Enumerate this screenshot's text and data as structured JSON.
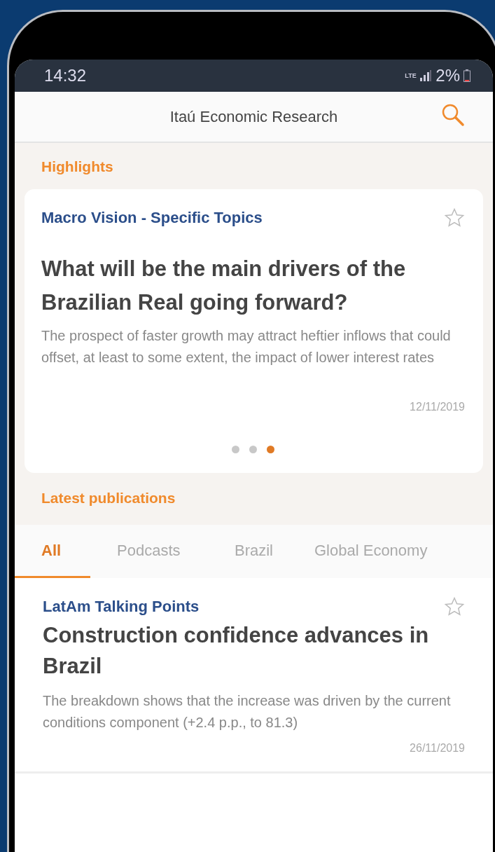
{
  "status_bar": {
    "time": "14:32",
    "network": "LTE",
    "battery": "2%"
  },
  "app_bar": {
    "title": "Itaú Economic Research"
  },
  "highlights": {
    "heading": "Highlights",
    "card": {
      "category": "Macro Vision - Specific Topics",
      "bookmarked": false,
      "title": "What will be the main drivers of the Brazilian Real going forward?",
      "summary": "The prospect of faster growth may attract heftier inflows that could offset, at least to some extent, the impact of lower interest rates",
      "date": "12/11/2019"
    },
    "dots": [
      {
        "selected": false
      },
      {
        "selected": false
      },
      {
        "selected": true
      }
    ]
  },
  "latest": {
    "heading": "Latest publications",
    "tabs": [
      {
        "label": "All",
        "selected": true
      },
      {
        "label": "Podcasts",
        "selected": false
      },
      {
        "label": "Brazil",
        "selected": false
      },
      {
        "label": "Global Economy",
        "selected": false
      }
    ],
    "articles": [
      {
        "category": "LatAm Talking Points",
        "bookmarked": false,
        "title": "Construction confidence advances in Brazil",
        "summary": "The breakdown shows that the increase was driven by the current conditions component (+2.4 p.p., to 81.3)",
        "date": "26/11/2019"
      }
    ]
  }
}
